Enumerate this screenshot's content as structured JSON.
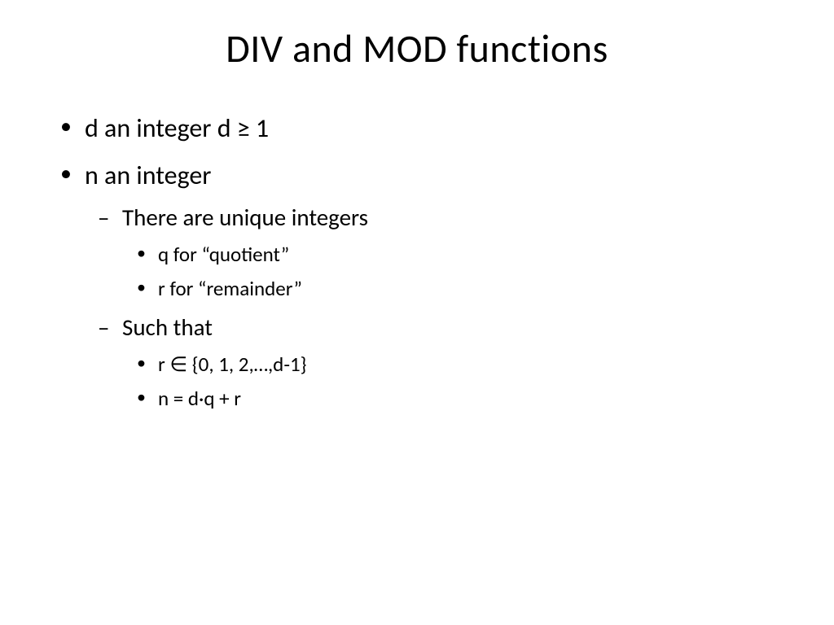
{
  "title": "DIV and MOD functions",
  "bullets": {
    "b1": "d an integer d ≥ 1",
    "b2": "n an integer",
    "b2_1": "There are unique integers",
    "b2_1_1": "q for “quotient”",
    "b2_1_2": "r for “remainder”",
    "b2_2": "Such that",
    "b2_2_1": "r ∈ {0, 1, 2,…,d-1}",
    "b2_2_2": "n = d·q + r"
  }
}
